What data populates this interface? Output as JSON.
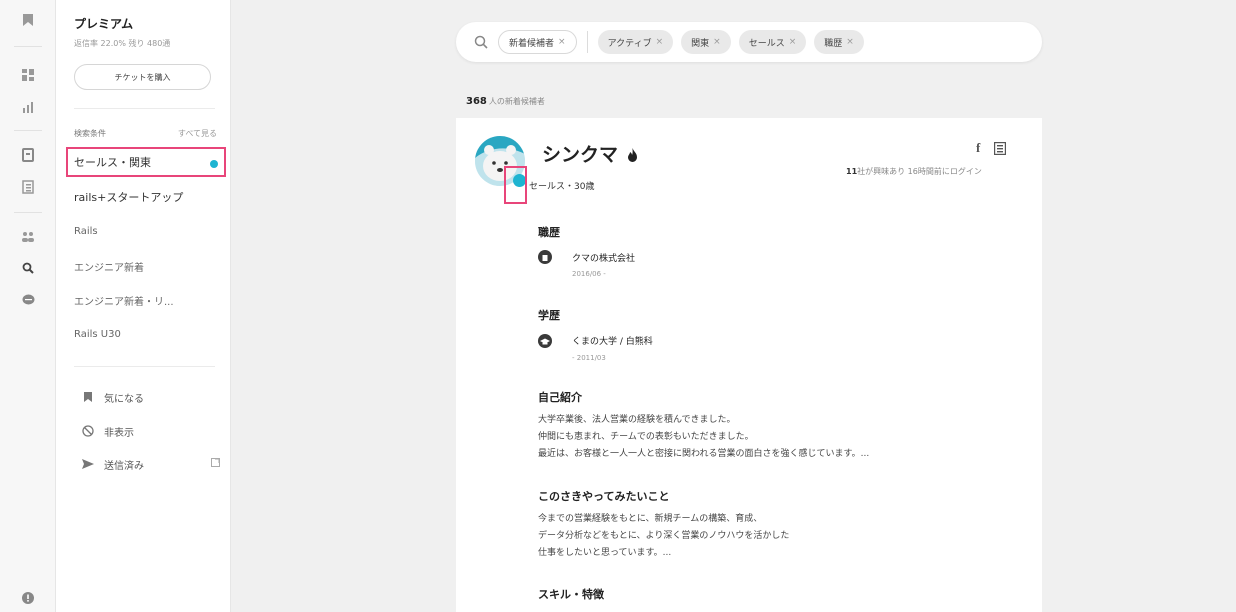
{
  "sidebar": {
    "plan_title": "プレミアム",
    "plan_sub": "返信率 22.0% 残り 480通",
    "ticket_button": "チケットを購入",
    "search_conditions_header": "検索条件",
    "see_all": "すべて見る",
    "conditions": [
      "セールス・関東",
      "rails+スタートアップ",
      "Rails",
      "エンジニア新着",
      "エンジニア新着・リ...",
      "Rails U30"
    ],
    "bottom_nav": [
      "気になる",
      "非表示",
      "送信済み"
    ]
  },
  "search": {
    "chips": [
      "新着候補者",
      "アクティブ",
      "関東",
      "セールス",
      "職歴"
    ],
    "chip_remove": "×"
  },
  "results": {
    "count": "368",
    "count_label": "人の新着候補者"
  },
  "candidate": {
    "name": "シンクマ",
    "subtitle": "セールス・30歳",
    "interest_count": "11",
    "interest_text": "社が興味あり 16時間前にログイン",
    "social_f": "f",
    "career_header": "職歴",
    "career": {
      "company": "クマの株式会社",
      "date": "2016/06 -"
    },
    "education_header": "学歴",
    "education": {
      "school": "くまの大学 / 白熊科",
      "date": "- 2011/03"
    },
    "intro_header": "自己紹介",
    "intro_lines": [
      "大学卒業後、法人営業の経験を積んできました。",
      "仲間にも恵まれ、チームでの表彰もいただきました。",
      "最近は、お客様と一人一人と密接に関われる営業の面白さを強く感じています。..."
    ],
    "want_header": "このさきやってみたいこと",
    "want_lines": [
      "今までの営業経験をもとに、新規チームの構築、育成、",
      "データ分析などをもとに、より深く営業のノウハウを活かした",
      "仕事をしたいと思っています。..."
    ],
    "skills_header": "スキル・特徴"
  },
  "colors": {
    "accent": "#1eb4d1",
    "highlight": "#e8457a"
  },
  "icons": [
    "bookmark-icon",
    "dashboard-icon",
    "bar-chart-icon",
    "document-icon",
    "list-icon",
    "people-icon",
    "search-icon",
    "chat-icon",
    "info-icon",
    "flame-icon",
    "facebook-icon",
    "resume-icon",
    "ban-icon",
    "send-icon",
    "external-link-icon",
    "building-icon",
    "graduation-icon"
  ]
}
